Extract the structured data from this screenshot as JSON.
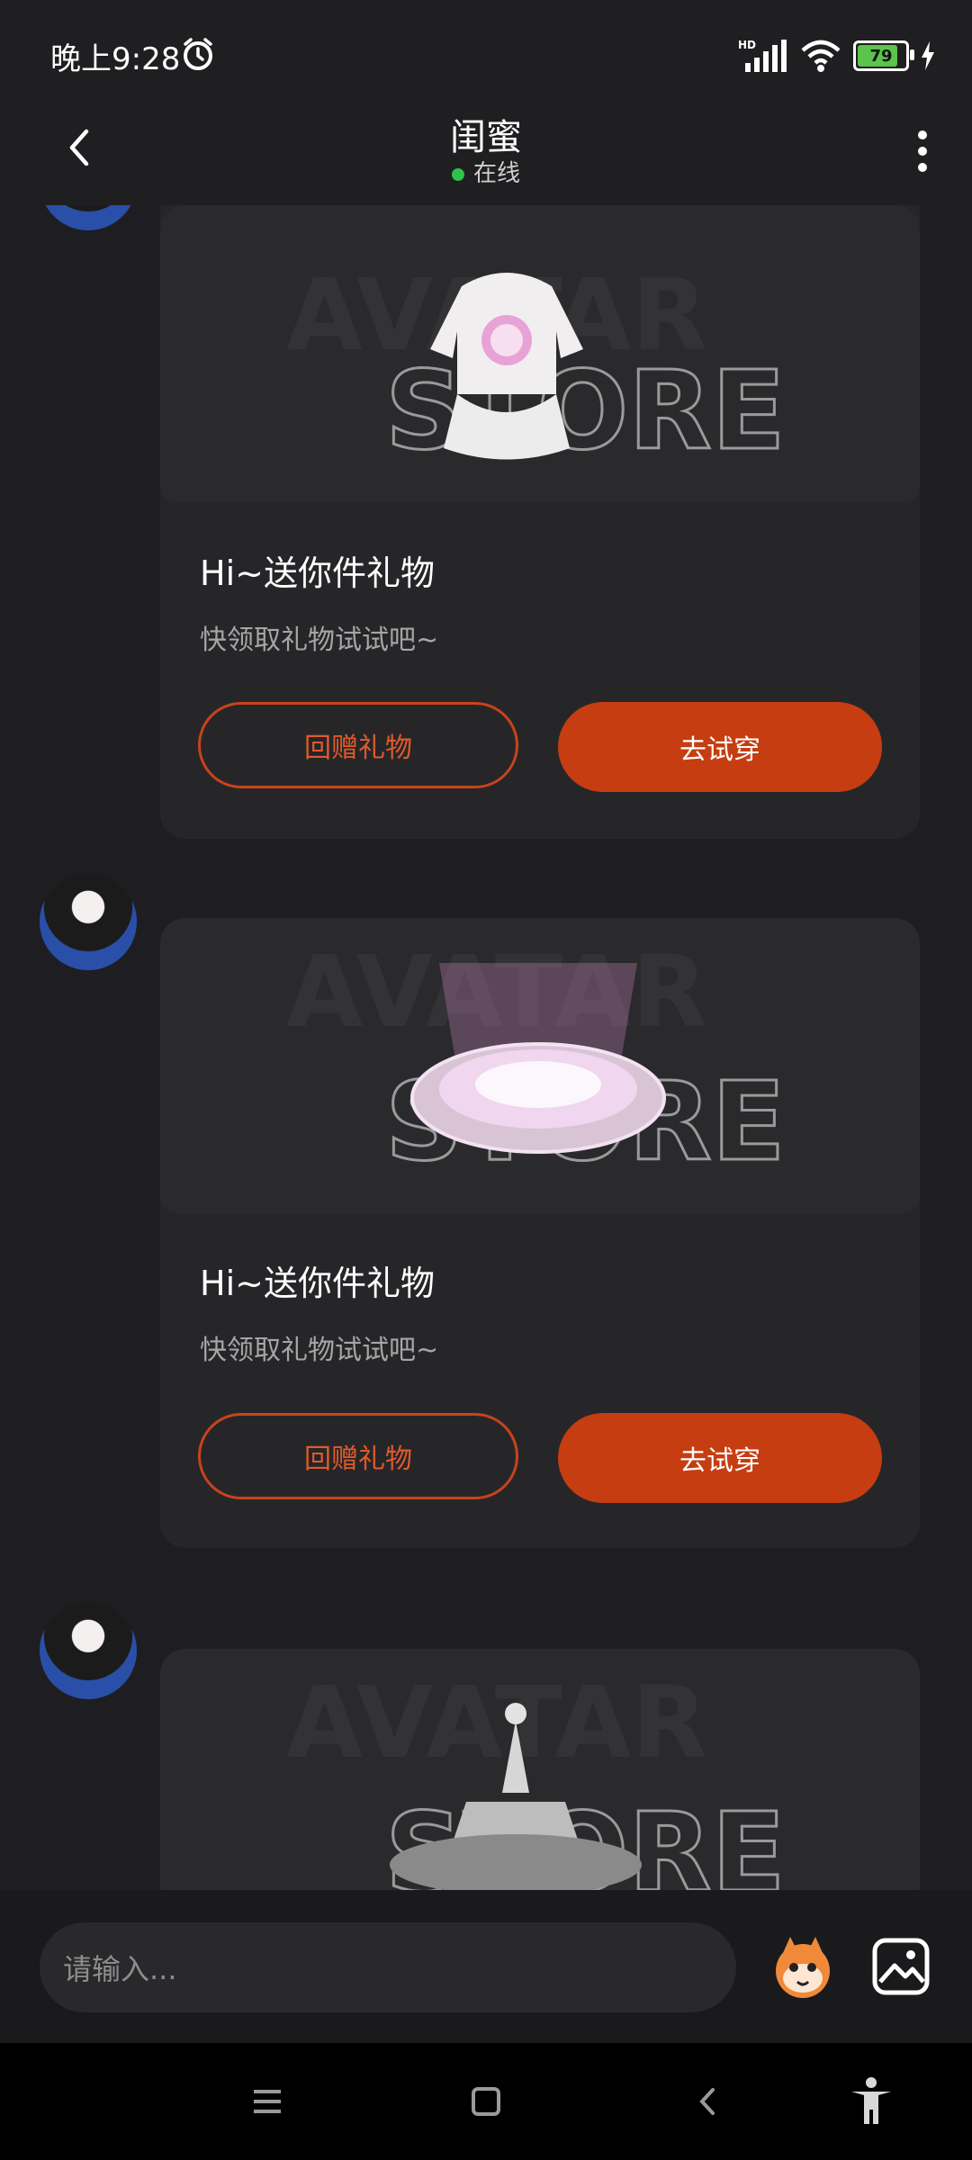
{
  "status_bar": {
    "time": "晚上9:28",
    "network": "HD",
    "battery": "79",
    "battery_level": 0.79
  },
  "header": {
    "title": "闺蜜",
    "status": "在线"
  },
  "messages": [
    {
      "title": "Hi~送你件礼物",
      "subtitle": "快领取礼物试试吧~",
      "gift_back_label": "回赠礼物",
      "try_on_label": "去试穿",
      "image_icon": "dress-icon"
    },
    {
      "title": "Hi~送你件礼物",
      "subtitle": "快领取礼物试试吧~",
      "gift_back_label": "回赠礼物",
      "try_on_label": "去试穿",
      "image_icon": "glow-platform-icon"
    },
    {
      "image_icon": "crown-icon"
    }
  ],
  "gift_banner": {
    "line1": "AVATAR",
    "line2": "STORE"
  },
  "input_bar": {
    "placeholder": "请输入..."
  },
  "colors": {
    "accent": "#c53d11",
    "accent_text": "#e05a2a",
    "background": "#1e1e22",
    "card": "#262629"
  }
}
